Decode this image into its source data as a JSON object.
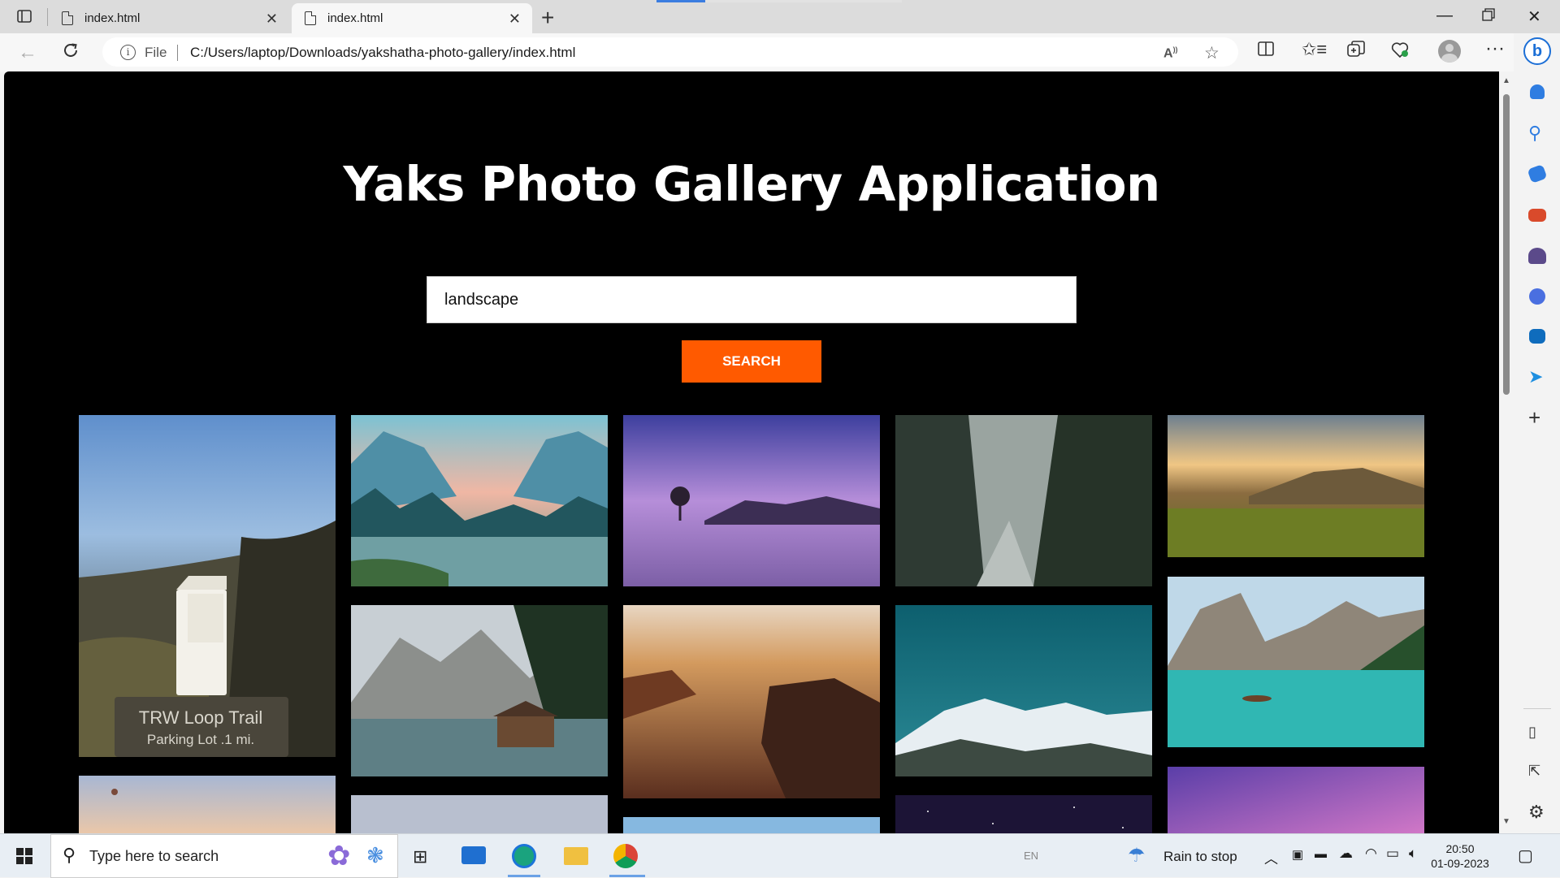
{
  "browser": {
    "tabs": [
      {
        "label": "index.html",
        "active": false
      },
      {
        "label": "index.html",
        "active": true
      }
    ],
    "address": {
      "security_label": "File",
      "url": "C:/Users/laptop/Downloads/yakshatha-photo-gallery/index.html"
    }
  },
  "page": {
    "title": "Yaks Photo Gallery Application",
    "search": {
      "value": "landscape"
    },
    "search_button_label": "SEARCH",
    "accent_color": "#ff5a00",
    "photos": [
      {
        "name": "milk-carton-trail-sign",
        "sign_title": "TRW  Loop  Trail",
        "sign_subtitle": "Parking  Lot  .1 mi."
      },
      {
        "name": "yosemite-valley-river"
      },
      {
        "name": "purple-lake-lone-tree"
      },
      {
        "name": "misty-forest-river"
      },
      {
        "name": "golden-meadow-sunset"
      },
      {
        "name": "mountain-lake-boathouse"
      },
      {
        "name": "desert-rocks-sunrise"
      },
      {
        "name": "snow-peaks-teal-sky"
      },
      {
        "name": "turquoise-lake-boat"
      },
      {
        "name": "hot-air-balloon-sky"
      },
      {
        "name": "pale-sky-partial"
      },
      {
        "name": "blue-sky-partial"
      },
      {
        "name": "starry-night-partial"
      },
      {
        "name": "purple-sunset-partial"
      }
    ]
  },
  "taskbar": {
    "search_placeholder": "Type here to search",
    "weather": "Rain to stop",
    "language": "EN",
    "time": "20:50",
    "date": "01-09-2023"
  }
}
